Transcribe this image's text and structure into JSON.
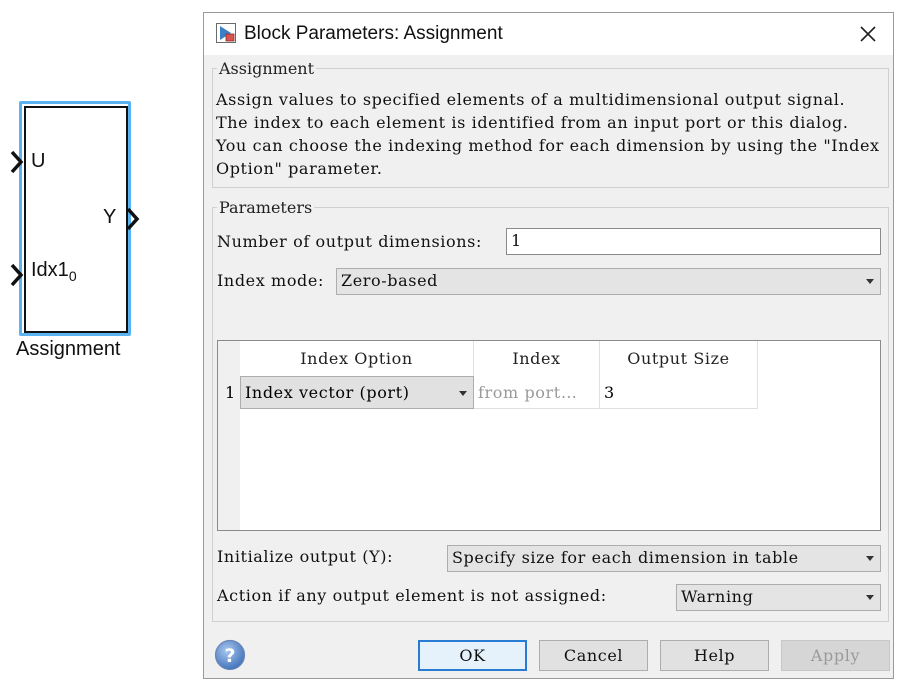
{
  "block": {
    "name": "Assignment",
    "input_port_1": "U",
    "input_port_2_main": "Idx1",
    "input_port_2_sub": "0",
    "output_port": "Y"
  },
  "dialog": {
    "title": "Block Parameters: Assignment",
    "title_icon": "simulink-block-icon",
    "close_icon": "close-icon",
    "description_group": {
      "title": "Assignment",
      "text": "Assign values to specified elements of a multidimensional output signal. The index to each element is identified from an input port or this dialog. You can choose the indexing method for each dimension by using the \"Index Option\" parameter."
    },
    "parameters_group": {
      "title": "Parameters",
      "num_dims_label": "Number of output dimensions:",
      "num_dims_value": "1",
      "index_mode_label": "Index mode:",
      "index_mode_value": "Zero-based",
      "table": {
        "headers": [
          "Index Option",
          "Index",
          "Output Size"
        ],
        "rows": [
          {
            "row_number": "1",
            "index_option": "Index vector (port)",
            "index": "from port…",
            "output_size": "3"
          }
        ]
      },
      "init_output_label": "Initialize output (Y):",
      "init_output_value": "Specify size for each dimension in table",
      "action_label": "Action if any output element is not assigned:",
      "action_value": "Warning"
    },
    "buttons": {
      "ok": "OK",
      "cancel": "Cancel",
      "help": "Help",
      "apply": "Apply"
    },
    "help_icon": "help-question-icon"
  },
  "colors": {
    "selection_blue": "#5ab3f0",
    "dialog_bg": "#f0f0f0",
    "default_button_border": "#2a7bd4"
  }
}
